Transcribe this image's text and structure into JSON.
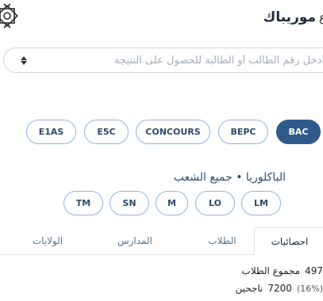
{
  "header": {
    "brand": "موريباك",
    "brand_mark": "ع",
    "logo_icon": "ornamental-star-logo"
  },
  "search": {
    "value": "",
    "placeholder": "أدخل رقم الطالب أو الطالبة للحصول على النتيجة"
  },
  "exams": [
    {
      "label": "BAC",
      "active": true
    },
    {
      "label": "BEPC",
      "active": false
    },
    {
      "label": "CONCOURS",
      "active": false
    },
    {
      "label": "E5C",
      "active": false
    },
    {
      "label": "E1AS",
      "active": false
    }
  ],
  "section": {
    "title": "الباكلوريا • جميع الشعب"
  },
  "streams": [
    "LM",
    "LO",
    "M",
    "SN",
    "TM"
  ],
  "tabs": [
    {
      "label": "احصائيات",
      "active": true
    },
    {
      "label": "الطلاب",
      "active": false
    },
    {
      "label": "المدارس",
      "active": false
    },
    {
      "label": "الولايات",
      "active": false
    }
  ],
  "stats": {
    "total_value": "497",
    "total_label": "مجموع الطلاب",
    "passed_value": "7200",
    "passed_label": "ناجحين",
    "passed_pct": "(16%)"
  },
  "colors": {
    "accent": "#2f5b8a",
    "pill_border": "#8fb3e6",
    "text_blue": "#2d4e77"
  }
}
